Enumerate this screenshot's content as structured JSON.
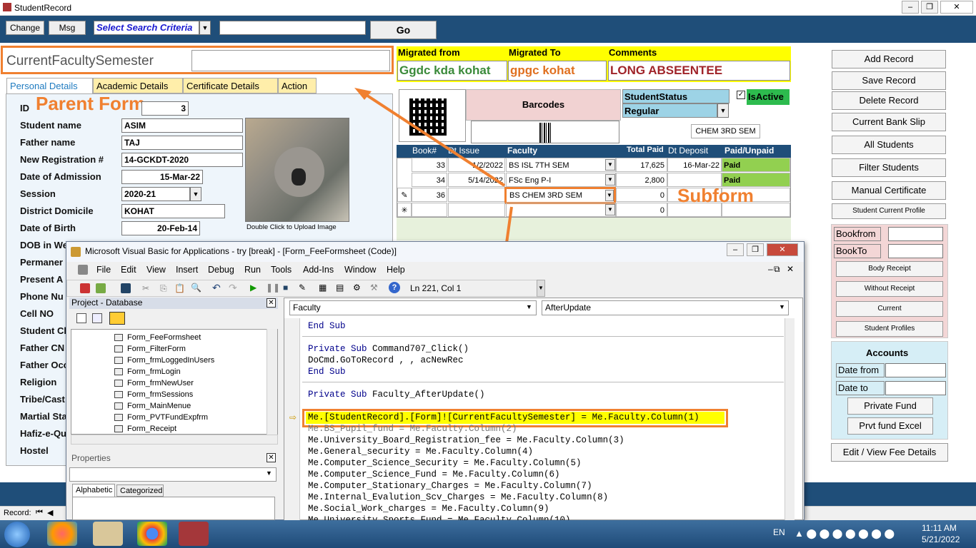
{
  "app_title": "StudentRecord",
  "toolbar": {
    "change_label": "Change",
    "msg_label": "Msg",
    "search_criteria": "Select Search Criteria",
    "go_label": "Go"
  },
  "parent": {
    "current_semester_label": "CurrentFacultySemester",
    "tabs": [
      "Personal Details",
      "Academic Details",
      "Certificate Details",
      "Action"
    ],
    "annotation": "Parent Form",
    "fields": [
      {
        "label": "ID",
        "value": "3"
      },
      {
        "label": "Student name",
        "value": "ASIM"
      },
      {
        "label": "Father name",
        "value": "TAJ"
      },
      {
        "label": "New Registration #",
        "value": "14-GCKDT-2020"
      },
      {
        "label": "Date of Admission",
        "value": "15-Mar-22"
      },
      {
        "label": "Session",
        "value": "2020-21"
      },
      {
        "label": "District Domicile",
        "value": "KOHAT"
      },
      {
        "label": "Date of Birth",
        "value": "20-Feb-14"
      }
    ],
    "hidden_labels": [
      "DOB in We",
      "Permaner",
      "Present A",
      "Phone Nu",
      "Cell NO",
      "Student Cl",
      "Father CN",
      "Father Occ",
      "Religion",
      "Tribe/Cast",
      "Martial Sta",
      "Hafiz-e-Qu",
      "Hostel"
    ],
    "upload_caption": "Double Click to Upload Image"
  },
  "migration": {
    "from_label": "Migrated from",
    "to_label": "Migrated To",
    "comments_label": "Comments",
    "from_value": "Ggdc kda kohat",
    "to_value": "gpgc kohat",
    "comments_value": "LONG ABSEENTEE"
  },
  "barcode": {
    "label": "Barcodes",
    "status_label": "StudentStatus",
    "status_value": "Regular",
    "isactive_label": "IsActive",
    "semester_value": "CHEM 3RD SEM"
  },
  "subform": {
    "annotation": "Subform",
    "headers": [
      "Book#",
      "Dt Issue",
      "Faculty",
      "Total Paid",
      "Dt Deposit",
      "Paid/Unpaid"
    ],
    "rows": [
      {
        "book": "33",
        "dt_issue": "1/2/2022",
        "faculty": "BS ISL 7TH SEM",
        "total": "17,625",
        "deposit": "16-Mar-22",
        "status": "Paid"
      },
      {
        "book": "34",
        "dt_issue": "5/14/2022",
        "faculty": "FSc Eng P-I",
        "total": "2,800",
        "deposit": "",
        "status": "Paid"
      },
      {
        "book": "36",
        "dt_issue": "",
        "faculty": "BS CHEM 3RD SEM",
        "total": "0",
        "deposit": "",
        "status": ""
      },
      {
        "book": "",
        "dt_issue": "",
        "faculty": "",
        "total": "0",
        "deposit": "",
        "status": ""
      }
    ]
  },
  "right_panel": {
    "buttons": [
      "Add Record",
      "Save Record",
      "Delete Record",
      "Current Bank Slip",
      "All Students",
      "Filter Students",
      "Manual Certificate",
      "Student Current Profile"
    ],
    "bookfrom_label": "Bookfrom",
    "bookto_label": "BookTo",
    "small_buttons": [
      "Body Receipt",
      "Without Receipt",
      "Current",
      "Student Profiles"
    ],
    "accounts_label": "Accounts",
    "date_from_label": "Date from",
    "date_to_label": "Date to",
    "private_fund": "Private Fund",
    "prvt_excel": "Prvt fund Excel",
    "edit_fee": "Edit / View Fee Details"
  },
  "vba": {
    "title": "Microsoft Visual Basic for Applications - try [break] - [Form_FeeFormsheet (Code)]",
    "menu": [
      "File",
      "Edit",
      "View",
      "Insert",
      "Debug",
      "Run",
      "Tools",
      "Add-Ins",
      "Window",
      "Help"
    ],
    "position": "Ln 221, Col 1",
    "project_title": "Project - Database",
    "tree": [
      "Form_FeeFormsheet",
      "Form_FilterForm",
      "Form_frmLoggedInUsers",
      "Form_frmLogin",
      "Form_frmNewUser",
      "Form_frmSessions",
      "Form_MainMenue",
      "Form_PVTFundExpfrm",
      "Form_Receipt"
    ],
    "properties_title": "Properties",
    "prop_tabs": [
      "Alphabetic",
      "Categorized"
    ],
    "object_combo": "Faculty",
    "proc_combo": "AfterUpdate",
    "code": [
      "End Sub",
      "",
      "Private Sub Command707_Click()",
      "DoCmd.GoToRecord , , acNewRec",
      "End Sub",
      "",
      "Private Sub Faculty_AfterUpdate()",
      "",
      "Me.[StudentRecord].[Form]![CurrentFacultySemester] = Me.Faculty.Column(1)",
      "Me.BS_Pupil_fund = Me.Faculty.Column(2)",
      "Me.University_Board_Registration_fee = Me.Faculty.Column(3)",
      "Me.General_security = Me.Faculty.Column(4)",
      "Me.Computer_Science_Security = Me.Faculty.Column(5)",
      "Me.Computer_Science_Fund = Me.Faculty.Column(6)",
      "Me.Computer_Stationary_Charges = Me.Faculty.Column(7)",
      "Me.Internal_Evalution_Scv_Charges = Me.Faculty.Column(8)",
      "Me.Social_Work_charges = Me.Faculty.Column(9)",
      "Me.University_Sports_Fund = Me.Faculty.Column(10)"
    ]
  },
  "status": {
    "record_label": "Record:"
  },
  "taskbar": {
    "lang": "EN",
    "time": "11:11 AM",
    "date": "5/21/2022"
  },
  "colors": {
    "accent": "#1f4e79",
    "orange": "#f08030",
    "yellow": "#ffff00",
    "paid": "#92d050"
  }
}
